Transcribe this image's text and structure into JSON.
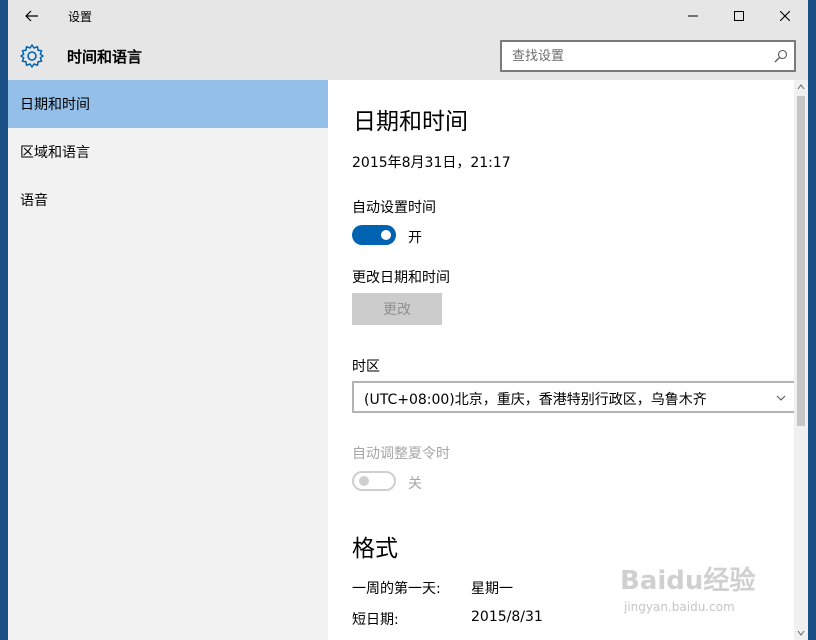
{
  "window": {
    "title": "设置",
    "back_icon": "back-arrow-icon",
    "minimize_icon": "minimize-icon",
    "maximize_icon": "maximize-icon",
    "close_icon": "close-icon"
  },
  "header": {
    "icon": "gear-icon",
    "title": "时间和语言",
    "search": {
      "placeholder": "查找设置",
      "value": "",
      "icon": "search-icon"
    }
  },
  "sidebar": {
    "items": [
      {
        "label": "日期和时间",
        "selected": true
      },
      {
        "label": "区域和语言",
        "selected": false
      },
      {
        "label": "语音",
        "selected": false
      }
    ],
    "selected_color": "#94bfe8"
  },
  "content": {
    "title": "日期和时间",
    "current_datetime": "2015年8月31日，21:17",
    "auto_time": {
      "label": "自动设置时间",
      "state_label": "开",
      "on": true
    },
    "change_datetime": {
      "label": "更改日期和时间",
      "button_label": "更改",
      "enabled": false
    },
    "timezone": {
      "label": "时区",
      "value": "(UTC+08:00)北京，重庆，香港特别行政区，乌鲁木齐"
    },
    "auto_dst": {
      "label": "自动调整夏令时",
      "state_label": "关",
      "on": false,
      "enabled": false
    },
    "format": {
      "title": "格式",
      "rows": [
        {
          "key": "一周的第一天:",
          "value": "星期一"
        },
        {
          "key": "短日期:",
          "value": "2015/8/31"
        }
      ]
    }
  },
  "watermark": {
    "main": "Baidu经验",
    "sub": "jingyan.baidu.com"
  },
  "colors": {
    "accent": "#0063b1",
    "titlebar": "#e6e6e6",
    "sidebar": "#f2f2f2",
    "desktop": "#1b4f86"
  }
}
